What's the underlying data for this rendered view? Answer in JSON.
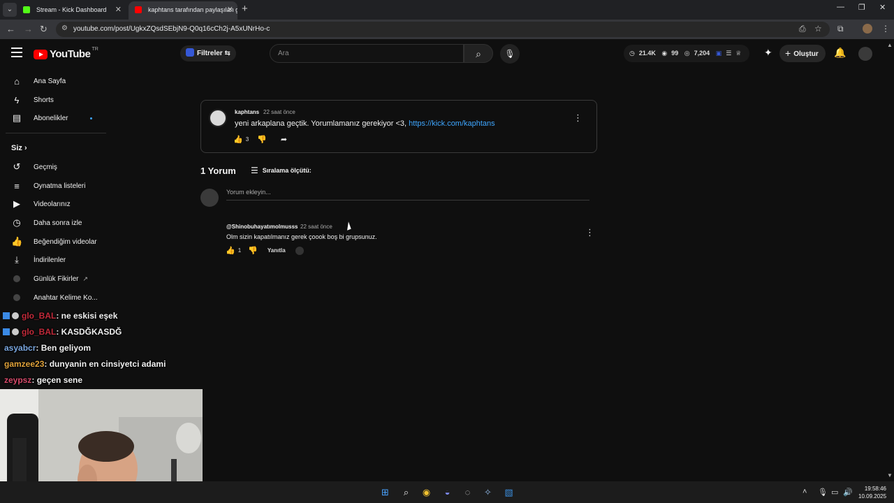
{
  "browser": {
    "tabs": [
      {
        "label": "Stream - Kick Dashboard",
        "favicon_color": "#53fc18"
      },
      {
        "label": "kaphtans tarafından paylaşılan gönderi",
        "favicon_color": "#ff0000"
      }
    ],
    "url": "youtube.com/post/UgkxZQsdSEbjN9-Q0q16cCh2j-A5xUNrHo-c"
  },
  "youtube": {
    "logo_text": "YouTube",
    "region": "TR",
    "filters_label": "Filtreler",
    "search_placeholder": "Ara",
    "stats": {
      "views": "21.4K",
      "watching": "99",
      "subs": "7,204"
    },
    "create_label": "Oluştur"
  },
  "sidebar": {
    "main": [
      {
        "label": "Ana Sayfa",
        "icon": "home-icon",
        "glyph": "⌂"
      },
      {
        "label": "Shorts",
        "icon": "shorts-icon",
        "glyph": "ϟ"
      },
      {
        "label": "Abonelikler",
        "icon": "subscriptions-icon",
        "glyph": "▤"
      }
    ],
    "you_label": "Siz",
    "you": [
      {
        "label": "Geçmiş",
        "icon": "history-icon",
        "glyph": "↺"
      },
      {
        "label": "Oynatma listeleri",
        "icon": "playlists-icon",
        "glyph": "≡"
      },
      {
        "label": "Videolarınız",
        "icon": "your-videos-icon",
        "glyph": "▶"
      },
      {
        "label": "Daha sonra izle",
        "icon": "watch-later-icon",
        "glyph": "◷"
      },
      {
        "label": "Beğendiğim videolar",
        "icon": "liked-videos-icon",
        "glyph": "👍"
      },
      {
        "label": "İndirilenler",
        "icon": "downloads-icon",
        "glyph": "⤓"
      }
    ],
    "extras": [
      {
        "label": "Günlük Fikirler"
      },
      {
        "label": "Anahtar Kelime Ko..."
      }
    ]
  },
  "post": {
    "author": "kaphtans",
    "time": "22 saat önce",
    "text": "yeni arkaplana geçtik. Yorumlamanız gerekiyor <3, ",
    "link": "https://kick.com/kaphtans",
    "likes": "3"
  },
  "comments": {
    "count_label": "1 Yorum",
    "sort_label": "Sıralama ölçütü:",
    "input_placeholder": "Yorum ekleyin...",
    "items": [
      {
        "author": "@Shinobuhayatımolmusss",
        "time": "22 saat önce",
        "text": "Olm sizin kapatılmanız gerek çoook boş bi grupsunuz.",
        "likes": "1",
        "reply_label": "Yanıtla"
      }
    ]
  },
  "chat": {
    "messages": [
      {
        "user": "glo_BAL",
        "text": ": ne eskisi eşek",
        "color": "#c22a3a"
      },
      {
        "user": "glo_BAL",
        "text": ": KASDĞKASDĞ",
        "color": "#c22a3a"
      },
      {
        "user": "asyabcr",
        "text": ": Ben geliyom",
        "color": "#7aa7e0"
      },
      {
        "user": "gamzee23",
        "text": ": dunyanin en cinsiyetci adami",
        "color": "#e0a23a"
      },
      {
        "user": "zeypsz",
        "text": ": geçen sene",
        "color": "#d64a6a"
      }
    ]
  },
  "taskbar": {
    "time": "19:58:46",
    "date": "10.09.2025"
  }
}
